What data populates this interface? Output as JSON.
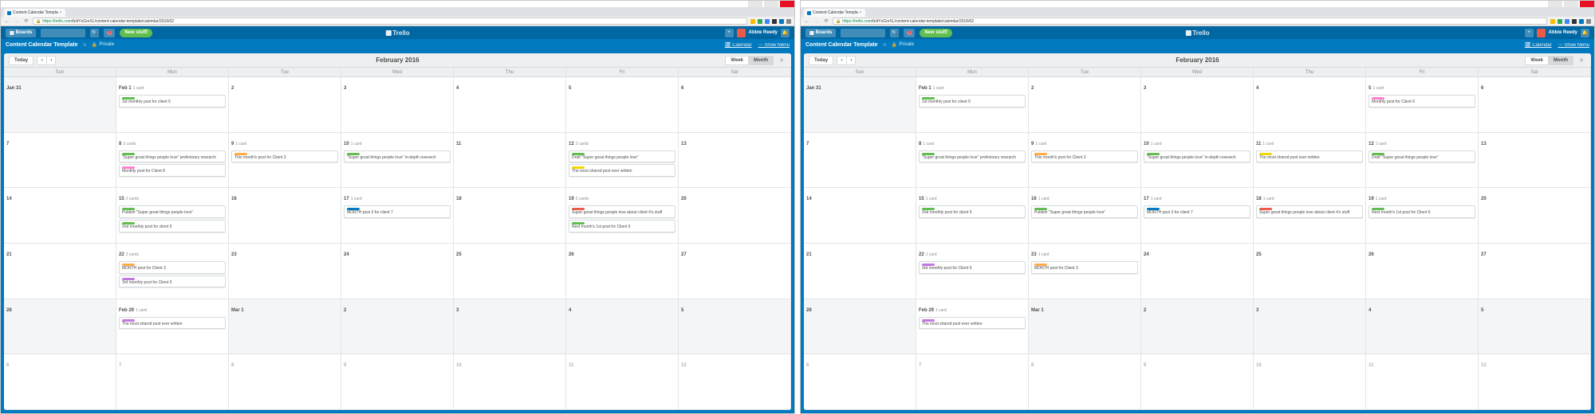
{
  "browser": {
    "tab_title": "Content Calendar Templa",
    "url_host": "https://",
    "url_domain": "trello.com",
    "url_path": "/b/dYzGorXL/content-calendar-template/calendar/2016/02"
  },
  "trello": {
    "boards_btn": "Boards",
    "new_stuff": "New stuff!",
    "logo": "Trello",
    "user": "Abbie Reedy",
    "plus": "+",
    "bell": "🔔"
  },
  "board": {
    "title": "Content Calendar Template",
    "star": "☆",
    "team_icon": "🏢",
    "privacy": "Private",
    "calendar_link": "Calendar",
    "show_menu": "Show Menu"
  },
  "toolbar": {
    "today": "Today",
    "prev": "‹",
    "next": "›",
    "title": "February 2016",
    "week": "Week",
    "month": "Month",
    "close": "✕"
  },
  "day_names": [
    "Sun",
    "Mon",
    "Tue",
    "Wed",
    "Thu",
    "Fri",
    "Sat"
  ],
  "card_count_single": "1 card",
  "card_count_two": "2 cards",
  "left_calendar": {
    "cells": [
      {
        "num": "Jan 31",
        "other": true
      },
      {
        "num": "Feb 1",
        "sub": "1 card",
        "cards": [
          {
            "labels": [
              "g"
            ],
            "text": "1st monthly post for client 5"
          }
        ]
      },
      {
        "num": "2"
      },
      {
        "num": "3"
      },
      {
        "num": "4"
      },
      {
        "num": "5"
      },
      {
        "num": "6"
      },
      {
        "num": "7"
      },
      {
        "num": "8",
        "sub": "2 cards",
        "cards": [
          {
            "labels": [
              "g"
            ],
            "text": "\"Super great things people love\" preliminary research"
          },
          {
            "labels": [
              "pk"
            ],
            "text": "Monthly post for Client 8"
          }
        ]
      },
      {
        "num": "9",
        "sub": "1 card",
        "cards": [
          {
            "labels": [
              "o"
            ],
            "text": "This month's post for Client 3"
          }
        ]
      },
      {
        "num": "10",
        "sub": "1 card",
        "cards": [
          {
            "labels": [
              "g"
            ],
            "text": "\"Super great things people love\" in-depth research"
          }
        ]
      },
      {
        "num": "11"
      },
      {
        "num": "12",
        "sub": "2 cards",
        "cards": [
          {
            "labels": [
              "g"
            ],
            "text": "Draft \"Super great things people love\""
          },
          {
            "labels": [
              "y"
            ],
            "text": "The most shared post ever written"
          }
        ]
      },
      {
        "num": "13"
      },
      {
        "num": "14"
      },
      {
        "num": "15",
        "sub": "2 cards",
        "cards": [
          {
            "labels": [
              "g"
            ],
            "text": "Publish \"Super great things people love\""
          },
          {
            "labels": [
              "g"
            ],
            "text": "2nd monthly post for client 5"
          }
        ]
      },
      {
        "num": "16"
      },
      {
        "num": "17",
        "sub": "1 card",
        "cards": [
          {
            "labels": [
              "b"
            ],
            "text": "MONTH post 3 for client 7"
          }
        ]
      },
      {
        "num": "18"
      },
      {
        "num": "19",
        "sub": "2 cards",
        "cards": [
          {
            "labels": [
              "r"
            ],
            "text": "Super great things people love about client 4's stuff"
          },
          {
            "labels": [
              "g"
            ],
            "text": "Next month's 1st post for Client 6"
          }
        ]
      },
      {
        "num": "20"
      },
      {
        "num": "21"
      },
      {
        "num": "22",
        "sub": "2 cards",
        "cards": [
          {
            "labels": [
              "o"
            ],
            "text": "MONTH post for Client 3"
          },
          {
            "labels": [
              "p"
            ],
            "text": "3rd monthly post for Client 5"
          }
        ]
      },
      {
        "num": "23"
      },
      {
        "num": "24"
      },
      {
        "num": "25"
      },
      {
        "num": "26"
      },
      {
        "num": "27"
      },
      {
        "num": "28",
        "other": true
      },
      {
        "num": "Feb 29",
        "sub": "1 card",
        "cards": [
          {
            "labels": [
              "p"
            ],
            "text": "The most shared post ever written"
          }
        ]
      },
      {
        "num": "Mar 1",
        "other": true
      },
      {
        "num": "2",
        "other": true
      },
      {
        "num": "3",
        "other": true
      },
      {
        "num": "4",
        "other": true
      },
      {
        "num": "5",
        "other": true
      },
      {
        "num": "6",
        "row6": true
      },
      {
        "num": "7",
        "row6": true
      },
      {
        "num": "8",
        "row6": true
      },
      {
        "num": "9",
        "row6": true
      },
      {
        "num": "10",
        "row6": true
      },
      {
        "num": "11",
        "row6": true
      },
      {
        "num": "12",
        "row6": true
      }
    ]
  },
  "right_calendar": {
    "cells": [
      {
        "num": "Jan 31",
        "other": true
      },
      {
        "num": "Feb 1",
        "sub": "1 card",
        "cards": [
          {
            "labels": [
              "g"
            ],
            "text": "1st monthly post for client 5"
          }
        ]
      },
      {
        "num": "2"
      },
      {
        "num": "3"
      },
      {
        "num": "4"
      },
      {
        "num": "5",
        "sub": "1 card",
        "cards": [
          {
            "labels": [
              "pk"
            ],
            "text": "Monthly post for Client 9"
          }
        ]
      },
      {
        "num": "6"
      },
      {
        "num": "7"
      },
      {
        "num": "8",
        "sub": "1 card",
        "cards": [
          {
            "labels": [
              "g"
            ],
            "text": "\"Super great things people love\" preliminary research"
          }
        ]
      },
      {
        "num": "9",
        "sub": "1 card",
        "cards": [
          {
            "labels": [
              "o"
            ],
            "text": "This month's post for Client 3"
          }
        ]
      },
      {
        "num": "10",
        "sub": "1 card",
        "cards": [
          {
            "labels": [
              "g"
            ],
            "text": "\"Super great things people love\" in-depth research"
          }
        ]
      },
      {
        "num": "11",
        "sub": "1 card",
        "cards": [
          {
            "labels": [
              "y"
            ],
            "text": "The most shared post ever written"
          }
        ]
      },
      {
        "num": "12",
        "sub": "1 card",
        "cards": [
          {
            "labels": [
              "g"
            ],
            "text": "Draft \"Super great things people love\""
          }
        ]
      },
      {
        "num": "13"
      },
      {
        "num": "14"
      },
      {
        "num": "15",
        "sub": "1 card",
        "cards": [
          {
            "labels": [
              "g"
            ],
            "text": "2nd monthly post for client 5"
          }
        ]
      },
      {
        "num": "16",
        "sub": "1 card",
        "cards": [
          {
            "labels": [
              "g"
            ],
            "text": "Publish \"Super great things people love\""
          }
        ]
      },
      {
        "num": "17",
        "sub": "1 card",
        "cards": [
          {
            "labels": [
              "b"
            ],
            "text": "MONTH post 3 for client 7"
          }
        ]
      },
      {
        "num": "18",
        "sub": "1 card",
        "cards": [
          {
            "labels": [
              "r"
            ],
            "text": "Super great things people love about client 4's stuff"
          }
        ]
      },
      {
        "num": "19",
        "sub": "1 card",
        "cards": [
          {
            "labels": [
              "g"
            ],
            "text": "Next month's 1st post for Client 6"
          }
        ]
      },
      {
        "num": "20"
      },
      {
        "num": "21"
      },
      {
        "num": "22",
        "sub": "1 card",
        "cards": [
          {
            "labels": [
              "p"
            ],
            "text": "3rd monthly post for Client 5"
          }
        ]
      },
      {
        "num": "23",
        "sub": "1 card",
        "cards": [
          {
            "labels": [
              "o"
            ],
            "text": "MONTH post for Client 3"
          }
        ]
      },
      {
        "num": "24"
      },
      {
        "num": "25"
      },
      {
        "num": "26"
      },
      {
        "num": "27"
      },
      {
        "num": "28",
        "other": true
      },
      {
        "num": "Feb 29",
        "sub": "1 card",
        "cards": [
          {
            "labels": [
              "p"
            ],
            "text": "The most shared post ever written"
          }
        ]
      },
      {
        "num": "Mar 1",
        "other": true
      },
      {
        "num": "2",
        "other": true
      },
      {
        "num": "3",
        "other": true
      },
      {
        "num": "4",
        "other": true
      },
      {
        "num": "5",
        "other": true
      },
      {
        "num": "6",
        "row6": true
      },
      {
        "num": "7",
        "row6": true
      },
      {
        "num": "8",
        "row6": true
      },
      {
        "num": "9",
        "row6": true
      },
      {
        "num": "10",
        "row6": true
      },
      {
        "num": "11",
        "row6": true
      },
      {
        "num": "12",
        "row6": true
      }
    ]
  }
}
